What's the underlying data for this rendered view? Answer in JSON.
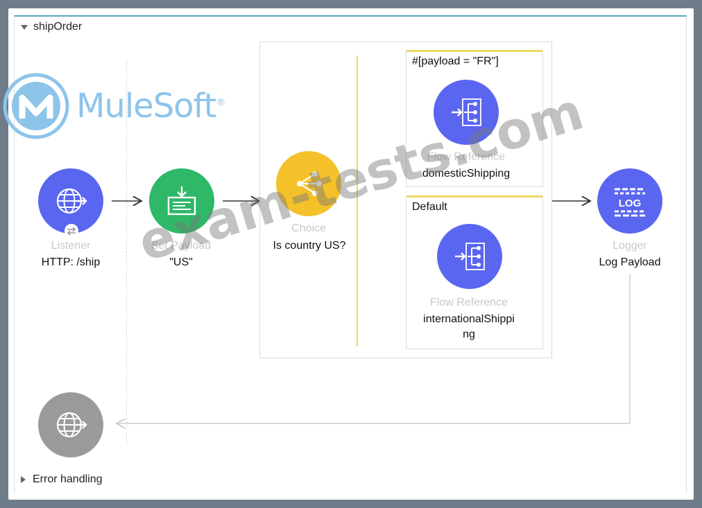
{
  "flow": {
    "name": "shipOrder",
    "error_handling_label": "Error handling"
  },
  "components": {
    "listener": {
      "type": "Listener",
      "name": "HTTP: /ship",
      "color": "#5a66f0"
    },
    "set_payload": {
      "type": "Set Payload",
      "name": "\"US\"",
      "color": "#2fb868"
    },
    "choice": {
      "type": "Choice",
      "name": "Is country US?",
      "color": "#f4c12a"
    },
    "logger": {
      "type": "Logger",
      "name": "Log Payload",
      "icon_text": "LOG",
      "color": "#5a66f0"
    },
    "response": {
      "color": "#9a9a9a"
    }
  },
  "routes": [
    {
      "condition": "#[payload = \"FR\"]",
      "component_type": "Flow Reference",
      "component_name": "domesticShipping"
    },
    {
      "condition": "Default",
      "component_type": "Flow Reference",
      "component_name_line1": "internationalShippi",
      "component_name_line2": "ng"
    }
  ],
  "logo": {
    "text": "MuleSoft",
    "mark": "®",
    "color": "#8dc4ea"
  },
  "watermark": {
    "text": "exam-tests.com"
  }
}
